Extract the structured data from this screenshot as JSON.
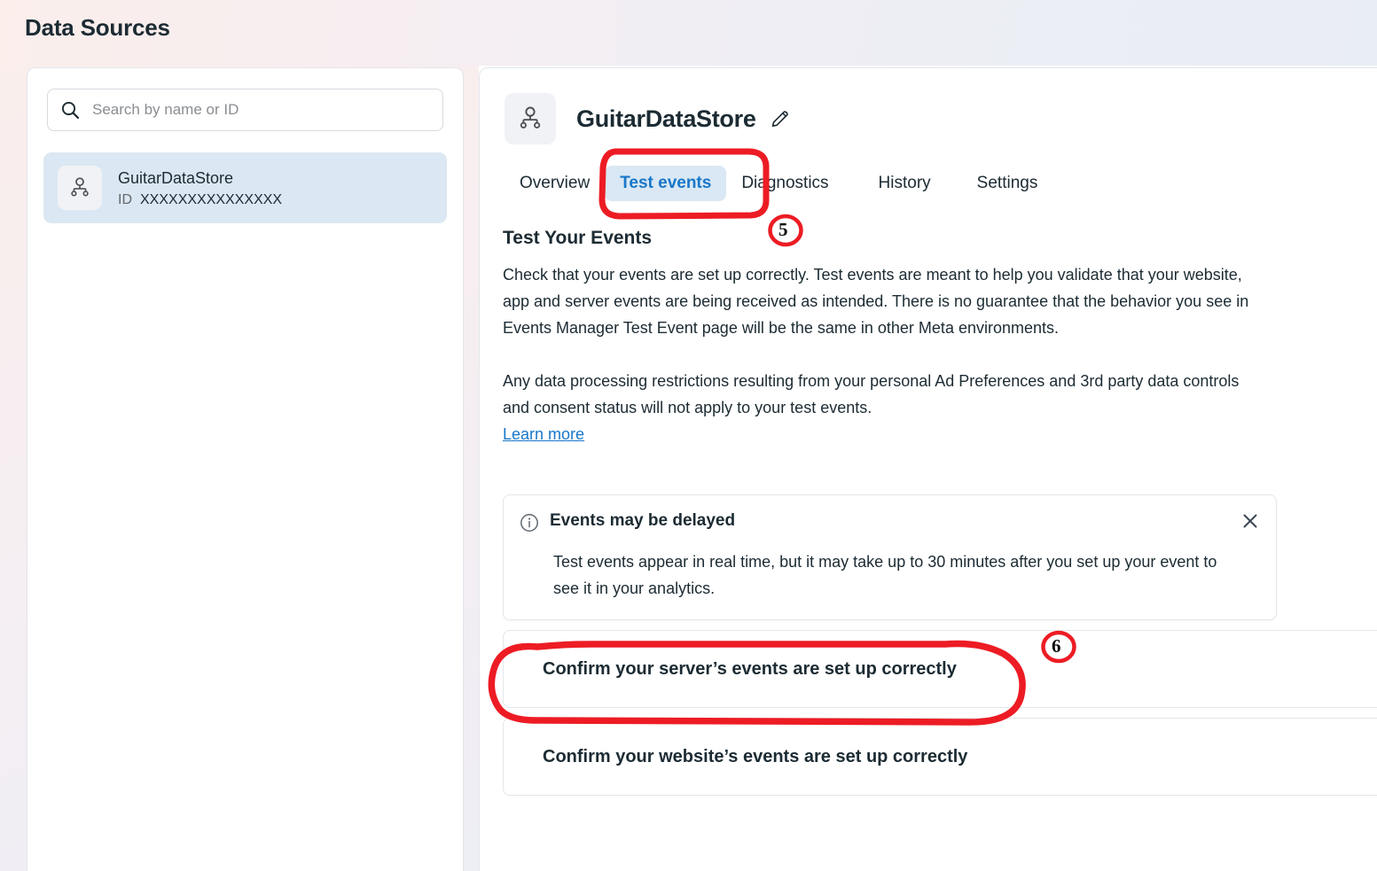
{
  "page": {
    "title": "Data Sources"
  },
  "sidebar": {
    "search": {
      "placeholder": "Search by name or ID",
      "value": "",
      "icon": "search-icon"
    },
    "sources": [
      {
        "name": "GuitarDataStore",
        "id_label": "ID",
        "id_value": "XXXXXXXXXXXXXXX",
        "icon": "dataset-node-icon",
        "selected": true
      }
    ]
  },
  "detail": {
    "icon": "dataset-node-icon",
    "name": "GuitarDataStore",
    "edit_icon": "pencil-icon",
    "tabs": [
      {
        "label": "Overview",
        "active": false
      },
      {
        "label": "Test events",
        "active": true
      },
      {
        "label": "Diagnostics",
        "active": false
      },
      {
        "label": "History",
        "active": false
      },
      {
        "label": "Settings",
        "active": false
      }
    ],
    "section_title": "Test Your Events",
    "paragraph_1": "Check that your events are set up correctly. Test events are meant to help you validate that your website, app and server events are being received as intended. There is no guarantee that the behavior you see in Events Manager Test Event page will be the same in other Meta environments.",
    "paragraph_2": "Any data processing restrictions resulting from your personal Ad Preferences and 3rd party data controls and consent status will not apply to your test events.",
    "learn_more": "Learn more",
    "banner": {
      "icon": "info-circle-icon",
      "title": "Events may be delayed",
      "text": "Test events appear in real time, but it may take up to 30 minutes after you set up your event to see it in your analytics.",
      "close_icon": "close-icon"
    },
    "accordions": [
      {
        "label": "Confirm your server’s events are set up correctly"
      },
      {
        "label": "Confirm your website’s events are set up correctly"
      }
    ]
  },
  "annotations": {
    "color": "#ED1C24",
    "markers": [
      {
        "number": "5",
        "target": "test-events-tab"
      },
      {
        "number": "6",
        "target": "confirm-server-events-accordion"
      }
    ]
  }
}
